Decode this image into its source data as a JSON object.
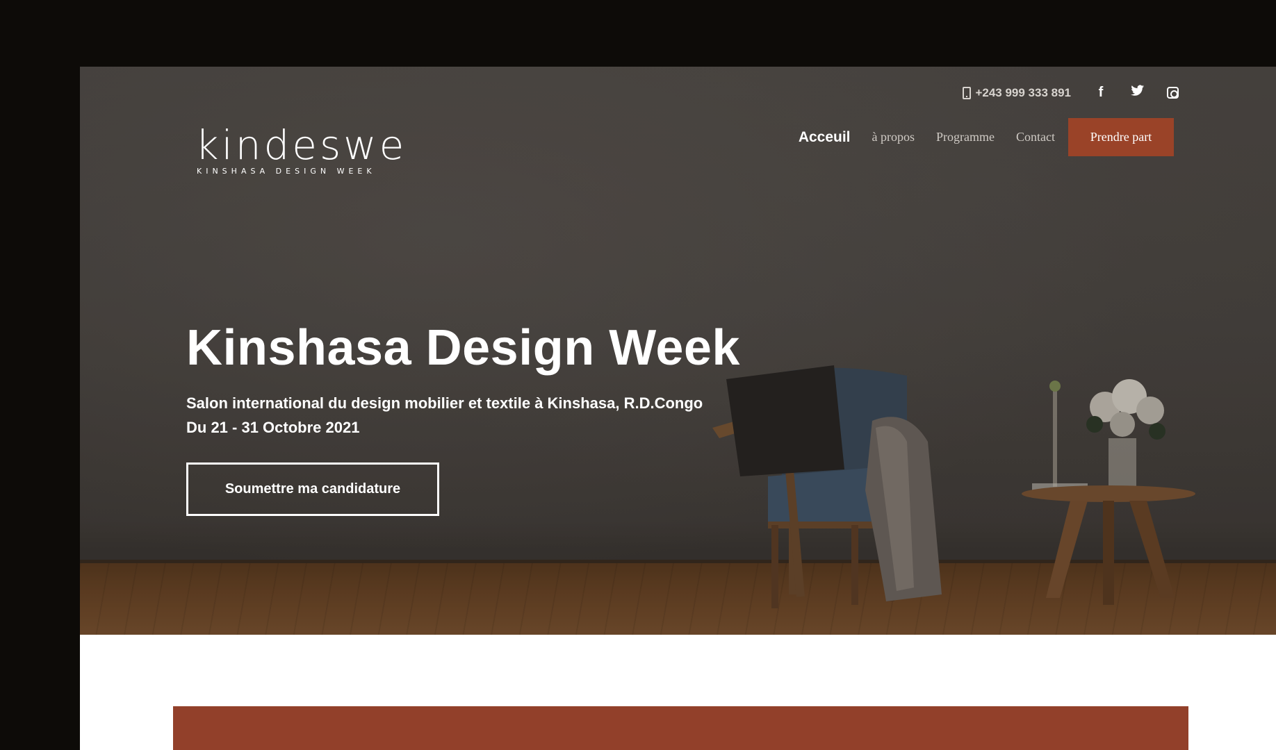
{
  "topbar": {
    "phone": "+243 999 333 891",
    "social": [
      "facebook-icon",
      "twitter-icon",
      "instagram-icon"
    ]
  },
  "logo": {
    "word": "kindeswe",
    "sub": "KINSHASA DESIGN WEEK"
  },
  "nav": {
    "items": [
      "Acceuil",
      "à propos",
      "Programme",
      "Contact"
    ],
    "cta": "Prendre part"
  },
  "hero": {
    "title": "Kinshasa Design Week",
    "subtitle_line1": "Salon international du design mobilier et textile à Kinshasa, R.D.Congo",
    "subtitle_line2": "Du 21 - 31 Octobre 2021",
    "button": "Soumettre ma candidature"
  },
  "colors": {
    "accent": "#9a4328",
    "band": "#92402a",
    "frame": "#0d0b08"
  }
}
